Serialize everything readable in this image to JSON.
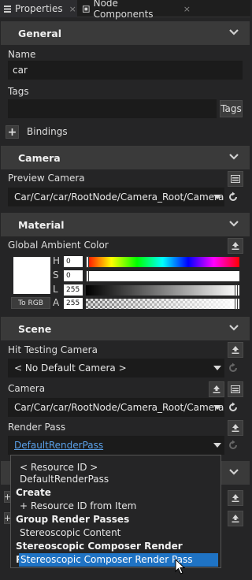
{
  "tabs": [
    {
      "label": "Properties",
      "close": "×"
    },
    {
      "label": "Node Components",
      "close": "×"
    }
  ],
  "general": {
    "title": "General",
    "name_label": "Name",
    "name_value": "car",
    "tags_label": "Tags",
    "tags_value": "",
    "tags_button": "Tags",
    "bindings_add": "+",
    "bindings_label": "Bindings"
  },
  "camera_section": {
    "title": "Camera",
    "preview_label": "Preview Camera",
    "preview_value": "Car/Car/car/RootNode/Camera_Root/Camera"
  },
  "material": {
    "title": "Material",
    "ambient_label": "Global Ambient Color",
    "swatch_color": "#ffffff",
    "to_rgb": "To RGB",
    "channels": [
      {
        "letter": "H",
        "value": "0"
      },
      {
        "letter": "S",
        "value": "0"
      },
      {
        "letter": "L",
        "value": "255"
      },
      {
        "letter": "A",
        "value": "255"
      }
    ]
  },
  "scene": {
    "title": "Scene",
    "hit_label": "Hit Testing Camera",
    "hit_value": "< No Default Camera >",
    "camera_label": "Camera",
    "camera_value": "Car/Car/car/RootNode/Camera_Root/Camera",
    "render_label": "Render Pass",
    "render_value": "DefaultRenderPass",
    "add_symbol": "+"
  },
  "popup": {
    "items": [
      {
        "text": "< Resource ID >",
        "kind": "indent"
      },
      {
        "text": "DefaultRenderPass",
        "kind": "indent"
      },
      {
        "text": "Create",
        "kind": "group"
      },
      {
        "text": "+ Resource ID from Item",
        "kind": "indent"
      },
      {
        "text": "Group Render Passes",
        "kind": "group"
      },
      {
        "text": "Stereoscopic Content",
        "kind": "indent"
      },
      {
        "text": "Stereoscopic Composer Render Passes",
        "kind": "group"
      },
      {
        "text": "Stereoscopic Composer Render Pass",
        "kind": "selected"
      }
    ]
  },
  "colors": {
    "background": "#252526",
    "section": "#3a3a3a",
    "field": "#1b1b1b",
    "selection": "#1f73c4",
    "link_text": "#5aa0e8"
  },
  "icons": [
    "properties-icon",
    "node-components-icon",
    "chevron-down-icon",
    "camera-preview-icon",
    "refresh-icon",
    "export-icon",
    "mouse-cursor-icon"
  ]
}
